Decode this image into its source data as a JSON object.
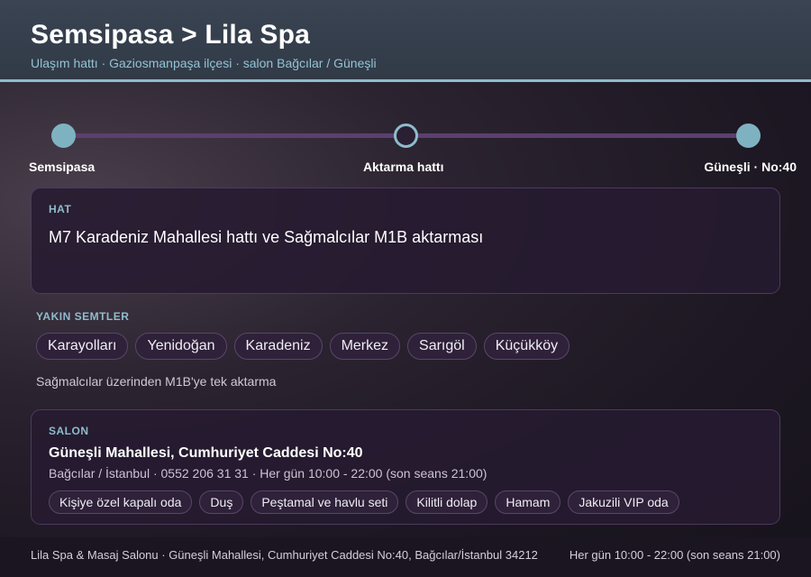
{
  "header": {
    "title": "Semsipasa > Lila Spa",
    "subtitle": "Ulaşım hattı · Gaziosmanpaşa ilçesi · salon Bağcılar / Güneşli"
  },
  "route": {
    "stops": [
      {
        "label": "Semsipasa",
        "style": "filled"
      },
      {
        "label": "Aktarma hattı",
        "style": "hollow"
      },
      {
        "label": "Güneşli · No:40",
        "style": "filled"
      }
    ]
  },
  "hat": {
    "kicker": "HAT",
    "text": "M7 Karadeniz Mahallesi hattı ve Sağmalcılar M1B aktarması"
  },
  "semtler": {
    "title": "YAKIN SEMTLER",
    "items": [
      "Karayolları",
      "Yenidoğan",
      "Karadeniz",
      "Merkez",
      "Sarıgöl",
      "Küçükköy"
    ],
    "note": "Sağmalcılar üzerinden M1B'ye tek aktarma"
  },
  "salon": {
    "kicker": "SALON",
    "address": "Güneşli Mahallesi, Cumhuriyet Caddesi No:40",
    "meta": "Bağcılar / İstanbul · 0552 206 31 31 · Her gün 10:00 - 22:00 (son seans 21:00)",
    "amenities": [
      "Kişiye özel kapalı oda",
      "Duş",
      "Peştamal ve havlu seti",
      "Kilitli dolap",
      "Hamam",
      "Jakuzili VIP oda"
    ]
  },
  "footer": {
    "left": "Lila Spa & Masaj Salonu · Güneşli Mahallesi, Cumhuriyet Caddesi No:40, Bağcılar/İstanbul 34212",
    "right": "Her gün 10:00 - 22:00 (son seans 21:00)"
  },
  "colors": {
    "accent": "#8fbccb",
    "route_line": "#5b3f72",
    "header_bg": "#343e4b",
    "card_bg": "#261a30"
  }
}
